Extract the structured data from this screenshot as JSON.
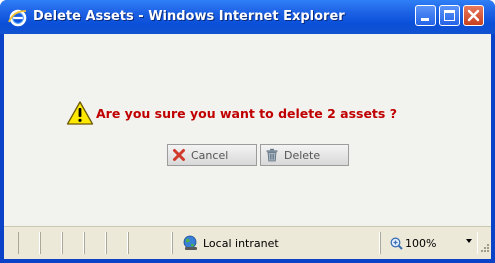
{
  "window": {
    "title": "Delete Assets - Windows Internet Explorer",
    "icon": "ie-icon",
    "controls": [
      "minimize-icon",
      "maximize-icon",
      "close-icon"
    ]
  },
  "dialog": {
    "message": "Are you sure you want to delete 2 assets ?",
    "message_icon": "warning-icon",
    "message_color": "#c00000",
    "buttons": {
      "cancel": {
        "label": "Cancel",
        "icon": "x-icon"
      },
      "delete": {
        "label": "Delete",
        "icon": "trash-icon"
      }
    }
  },
  "statusbar": {
    "zone": "Local intranet",
    "zone_icon": "globe-icon",
    "zoom": "100%",
    "zoom_icon": "zoom-icon"
  }
}
